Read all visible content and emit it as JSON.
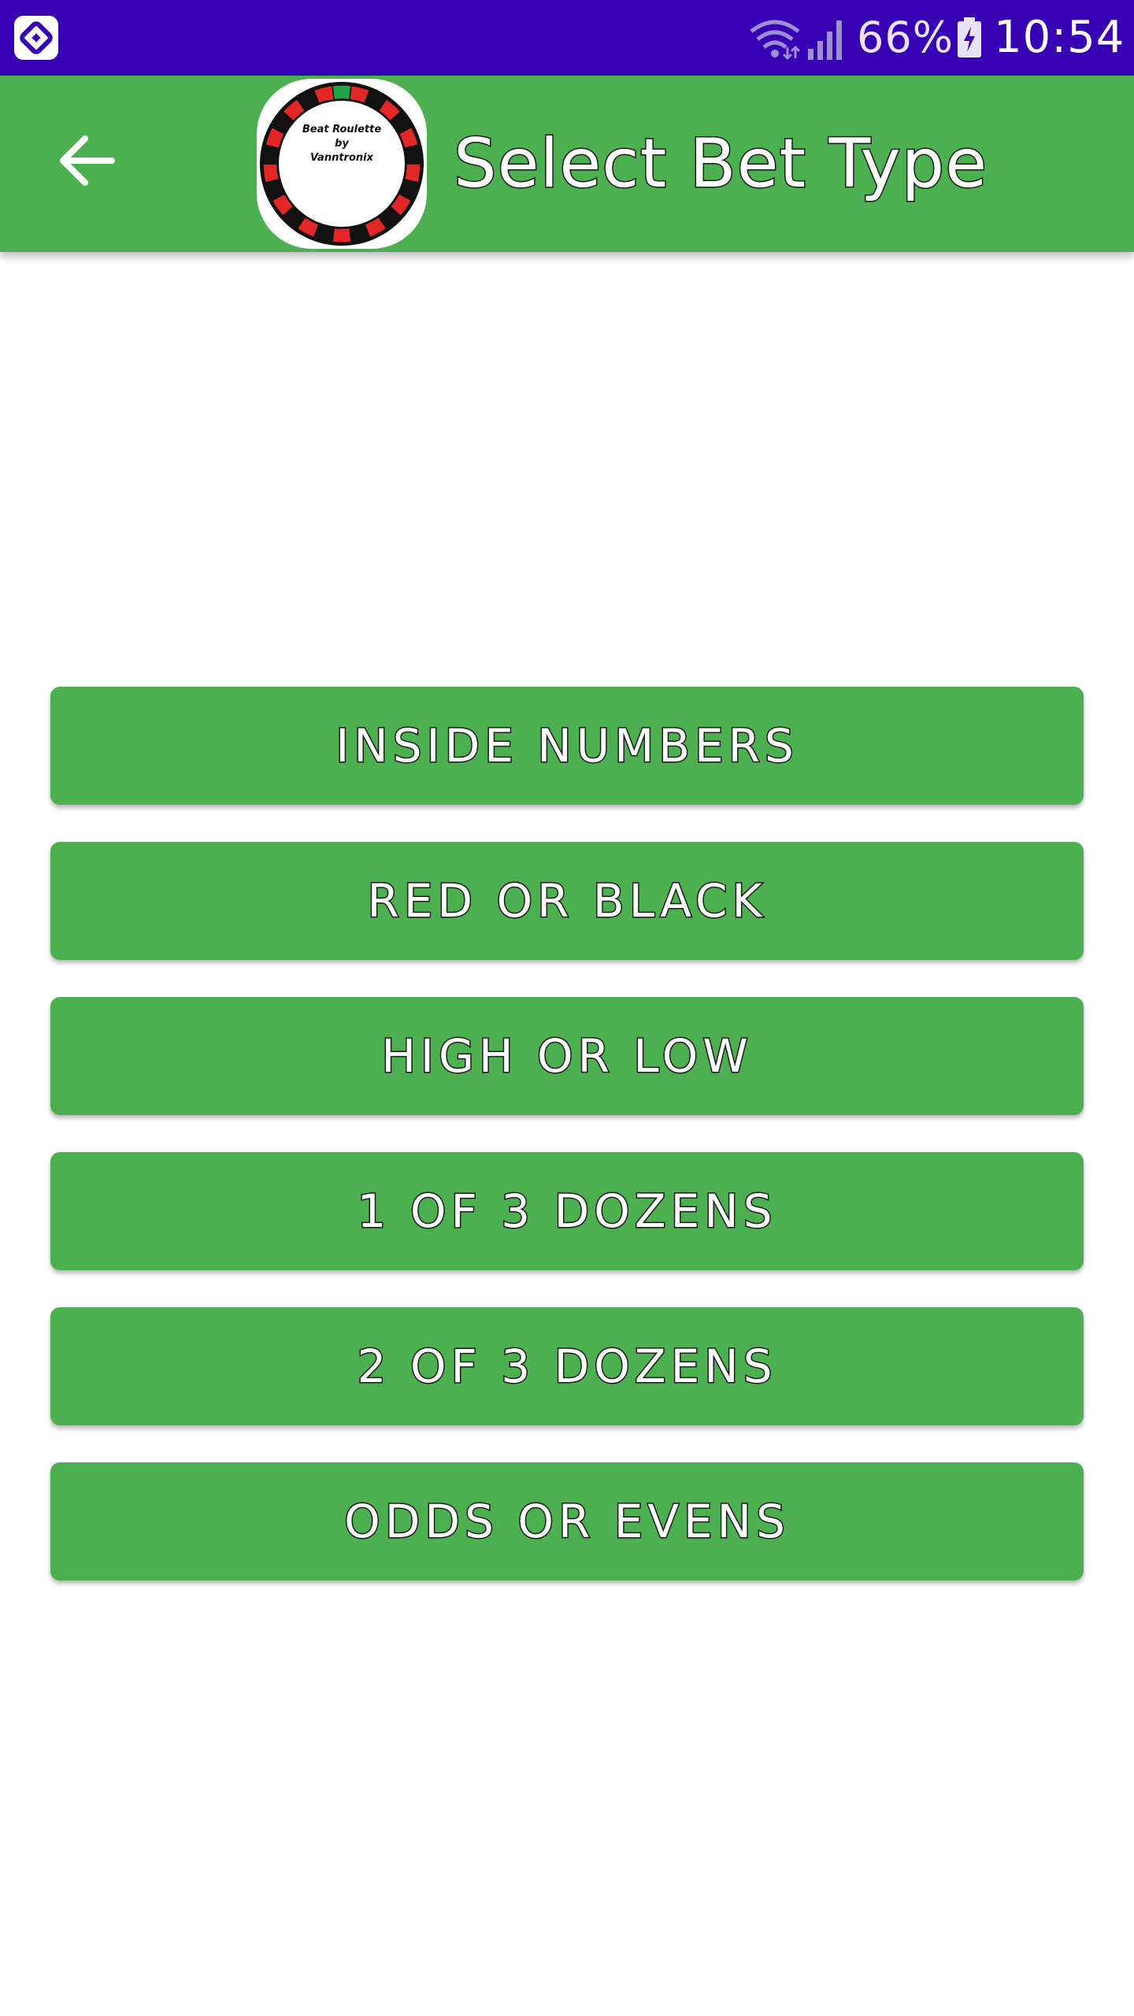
{
  "status_bar": {
    "battery_percent": "66%",
    "time": "10:54",
    "icons": [
      "app-logo-icon",
      "wifi-icon",
      "signal-icon",
      "battery-charging-icon"
    ]
  },
  "app_bar": {
    "back_icon": "arrow-left-icon",
    "logo_text_line1": "Beat Roulette",
    "logo_text_line2": "by",
    "logo_text_line3": "Vanntronix",
    "title": "Select Bet Type"
  },
  "bet_types": [
    {
      "label": "INSIDE NUMBERS"
    },
    {
      "label": "RED OR BLACK"
    },
    {
      "label": "HIGH OR LOW"
    },
    {
      "label": "1 OF 3 DOZENS"
    },
    {
      "label": "2 OF 3 DOZENS"
    },
    {
      "label": "ODDS OR EVENS"
    }
  ],
  "colors": {
    "status_bar": "#3700b3",
    "primary": "#4caf50",
    "text_on_primary": "#ffffff",
    "roulette_red": "#e32626",
    "roulette_black": "#111111",
    "roulette_green": "#22a34a"
  }
}
